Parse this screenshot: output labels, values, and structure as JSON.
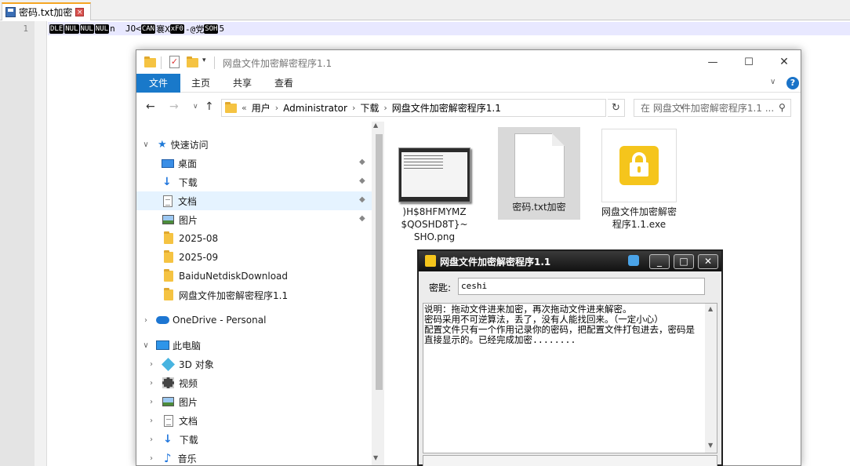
{
  "notepad": {
    "tab_title": "密码.txt加密",
    "tab_close": "×",
    "line_number": "1",
    "line_tokens": [
      {
        "kind": "ctrl",
        "text": "DLE"
      },
      {
        "kind": "ctrl",
        "text": "NUL"
      },
      {
        "kind": "ctrl",
        "text": "NUL"
      },
      {
        "kind": "ctrl",
        "text": "NUL"
      },
      {
        "kind": "text",
        "text": "n  JO<"
      },
      {
        "kind": "ctrl",
        "text": "CAN"
      },
      {
        "kind": "text",
        "text": "褰X"
      },
      {
        "kind": "ctrl",
        "text": "xF0"
      },
      {
        "kind": "text",
        "text": "-@党"
      },
      {
        "kind": "ctrl",
        "text": "SOH"
      },
      {
        "kind": "text",
        "text": "5"
      }
    ]
  },
  "explorer": {
    "title": "网盘文件加密解密程序1.1",
    "qa_check": "✓",
    "qa_drop": "▾",
    "win_min": "—",
    "win_max": "☐",
    "win_close": "✕",
    "ribbon": {
      "file": "文件",
      "home": "主页",
      "share": "共享",
      "view": "查看",
      "expand": "∨",
      "help": "?"
    },
    "nav": {
      "back": "←",
      "forward": "→",
      "recent": "∨",
      "up": "↑",
      "refresh": "↻",
      "address_drop": "∨"
    },
    "breadcrumb": [
      "«",
      "用户",
      "›",
      "Administrator",
      "›",
      "下载",
      "›",
      "网盘文件加密解密程序1.1"
    ],
    "search_placeholder": "在 网盘文件加密解密程序1.1 ...",
    "search_icon": "⚲",
    "tree": {
      "quick_access": "快速访问",
      "desktop": "桌面",
      "downloads": "下载",
      "documents": "文档",
      "pictures": "图片",
      "f2025_08": "2025-08",
      "f2025_09": "2025-09",
      "baidu": "BaiduNetdiskDownload",
      "encrypt_folder": "网盘文件加密解密程序1.1",
      "onedrive": "OneDrive - Personal",
      "this_pc": "此电脑",
      "objects3d": "3D 对象",
      "videos": "视频",
      "pc_pictures": "图片",
      "pc_documents": "文档",
      "pc_downloads": "下载",
      "music": "音乐"
    },
    "files": {
      "png": ")H$8HFMYMZ$QOSHD8T}~SHO.png",
      "txt": "密码.txt加密",
      "exe": "网盘文件加密解密程序1.1.exe"
    }
  },
  "dialog": {
    "title": "网盘文件加密解密程序1.1",
    "min": "_",
    "max": "□",
    "close": "✕",
    "password_label": "密匙:",
    "password_value": "ceshi",
    "log": "说明：拖动文件进来加密，再次拖动文件进来解密。\n密码采用不可逆算法，丢了，没有人能找回来。（一定小心）\n配置文件只有一个作用记录你的密码，把配置文件打包进去，密码是直接显示的。已经完成加密........"
  },
  "icons": {
    "chevron_right": "›",
    "chevron_down": "∨",
    "pin": "📌"
  }
}
